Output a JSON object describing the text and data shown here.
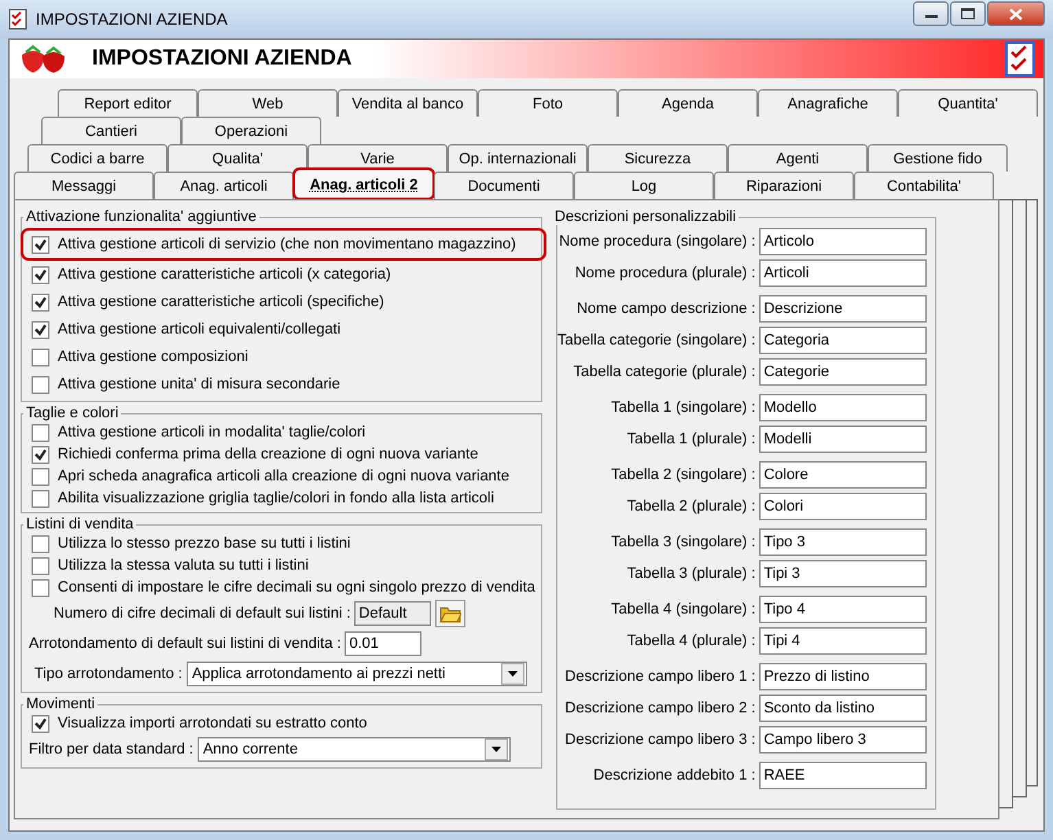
{
  "window": {
    "title": "IMPOSTAZIONI AZIENDA"
  },
  "header": {
    "title": "IMPOSTAZIONI AZIENDA"
  },
  "tab_rows": [
    [
      {
        "label": "Report editor",
        "selected": false,
        "highlighted": false
      },
      {
        "label": "Web",
        "selected": false,
        "highlighted": false
      },
      {
        "label": "Vendita al banco",
        "selected": false,
        "highlighted": false
      },
      {
        "label": "Foto",
        "selected": false,
        "highlighted": false
      },
      {
        "label": "Agenda",
        "selected": false,
        "highlighted": false
      },
      {
        "label": "Anagrafiche",
        "selected": false,
        "highlighted": false
      },
      {
        "label": "Quantita'",
        "selected": false,
        "highlighted": false
      }
    ],
    [
      {
        "label": "Cantieri",
        "selected": false,
        "highlighted": false
      },
      {
        "label": "Operazioni",
        "selected": false,
        "highlighted": false
      }
    ],
    [
      {
        "label": "Codici a barre",
        "selected": false,
        "highlighted": false
      },
      {
        "label": "Qualita'",
        "selected": false,
        "highlighted": false
      },
      {
        "label": "Varie",
        "selected": false,
        "highlighted": false
      },
      {
        "label": "Op. internazionali",
        "selected": false,
        "highlighted": false
      },
      {
        "label": "Sicurezza",
        "selected": false,
        "highlighted": false
      },
      {
        "label": "Agenti",
        "selected": false,
        "highlighted": false
      },
      {
        "label": "Gestione fido",
        "selected": false,
        "highlighted": false
      }
    ],
    [
      {
        "label": "Messaggi",
        "selected": false,
        "highlighted": false
      },
      {
        "label": "Anag. articoli",
        "selected": false,
        "highlighted": false
      },
      {
        "label": "Anag. articoli 2",
        "selected": true,
        "highlighted": true
      },
      {
        "label": "Documenti",
        "selected": false,
        "highlighted": false
      },
      {
        "label": "Log",
        "selected": false,
        "highlighted": false
      },
      {
        "label": "Riparazioni",
        "selected": false,
        "highlighted": false
      },
      {
        "label": "Contabilita'",
        "selected": false,
        "highlighted": false
      }
    ]
  ],
  "features": {
    "title": "Attivazione funzionalita' aggiuntive",
    "options": [
      {
        "label": "Attiva gestione articoli di servizio (che non movimentano magazzino)",
        "checked": true,
        "highlighted": true
      },
      {
        "label": "Attiva gestione caratteristiche articoli (x categoria)",
        "checked": true,
        "highlighted": false
      },
      {
        "label": "Attiva gestione caratteristiche articoli (specifiche)",
        "checked": true,
        "highlighted": false
      },
      {
        "label": "Attiva gestione articoli equivalenti/collegati",
        "checked": true,
        "highlighted": false
      },
      {
        "label": "Attiva gestione composizioni",
        "checked": false,
        "highlighted": false
      },
      {
        "label": "Attiva gestione unita' di misura secondarie",
        "checked": false,
        "highlighted": false
      }
    ]
  },
  "sizes_colors": {
    "title": "Taglie e colori",
    "options": [
      {
        "label": "Attiva gestione articoli in modalita' taglie/colori",
        "checked": false
      },
      {
        "label": "Richiedi conferma prima della creazione di ogni nuova variante",
        "checked": true
      },
      {
        "label": "Apri scheda anagrafica articoli alla creazione di ogni nuova variante",
        "checked": false
      },
      {
        "label": "Abilita visualizzazione griglia taglie/colori in fondo alla lista articoli",
        "checked": false
      }
    ]
  },
  "price_lists": {
    "title": "Listini di vendita",
    "options": [
      {
        "label": "Utilizza lo stesso prezzo base su tutti i listini",
        "checked": false
      },
      {
        "label": "Utilizza la stessa valuta su tutti i listini",
        "checked": false
      },
      {
        "label": "Consenti di impostare le cifre decimali su ogni singolo prezzo di vendita",
        "checked": false
      }
    ],
    "decimals": {
      "label": "Numero di cifre decimali di default sui listini :",
      "value": "Default",
      "readonly": true
    },
    "rounding": {
      "label": "Arrotondamento di default sui listini di vendita :",
      "value": "0.01"
    },
    "rounding_type": {
      "label": "Tipo arrotondamento :",
      "value": "Applica arrotondamento ai prezzi netti"
    }
  },
  "movements": {
    "title": "Movimenti",
    "options": [
      {
        "label": "Visualizza importi arrotondati su estratto conto",
        "checked": true
      }
    ],
    "date_filter": {
      "label": "Filtro per data standard :",
      "value": "Anno corrente"
    }
  },
  "descriptions": {
    "title": "Descrizioni personalizzabili",
    "sections": [
      [
        {
          "label": "Nome procedura (singolare) :",
          "value": "Articolo"
        },
        {
          "label": "Nome procedura (plurale) :",
          "value": "Articoli"
        }
      ],
      [
        {
          "label": "Nome campo descrizione :",
          "value": "Descrizione"
        },
        {
          "label": "Tabella categorie (singolare) :",
          "value": "Categoria"
        },
        {
          "label": "Tabella categorie (plurale) :",
          "value": "Categorie"
        }
      ],
      [
        {
          "label": "Tabella 1 (singolare) :",
          "value": "Modello"
        },
        {
          "label": "Tabella 1 (plurale) :",
          "value": "Modelli"
        }
      ],
      [
        {
          "label": "Tabella 2 (singolare) :",
          "value": "Colore"
        },
        {
          "label": "Tabella 2 (plurale) :",
          "value": "Colori"
        }
      ],
      [
        {
          "label": "Tabella 3 (singolare) :",
          "value": "Tipo 3"
        },
        {
          "label": "Tabella 3 (plurale) :",
          "value": "Tipi 3"
        }
      ],
      [
        {
          "label": "Tabella 4 (singolare) :",
          "value": "Tipo 4"
        },
        {
          "label": "Tabella 4 (plurale) :",
          "value": "Tipi 4"
        }
      ],
      [
        {
          "label": "Descrizione campo libero 1 :",
          "value": "Prezzo di listino"
        },
        {
          "label": "Descrizione campo libero 2 :",
          "value": "Sconto da listino"
        },
        {
          "label": "Descrizione campo libero 3 :",
          "value": "Campo libero 3"
        }
      ],
      [
        {
          "label": "Descrizione addebito 1 :",
          "value": "RAEE"
        }
      ]
    ]
  }
}
